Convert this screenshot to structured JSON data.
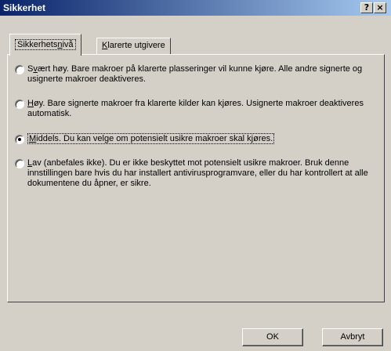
{
  "window": {
    "title": "Sikkerhet",
    "help_label": "?",
    "close_label": "×"
  },
  "tabs": [
    {
      "label_prefix": "Sikkerhets",
      "label_accel": "n",
      "label_suffix": "ivå",
      "active": true
    },
    {
      "label_prefix": "",
      "label_accel": "K",
      "label_suffix": "larerte utgivere",
      "active": false
    }
  ],
  "options": [
    {
      "label_prefix": "S",
      "label_accel": "v",
      "label_suffix": "ært høy. Bare makroer på klarerte plasseringer vil kunne kjøre. Alle andre signerte og usignerte makroer deaktiveres.",
      "selected": false
    },
    {
      "label_prefix": "",
      "label_accel": "H",
      "label_suffix": "øy. Bare signerte makroer fra klarerte kilder kan kjøres. Usignerte makroer deaktiveres automatisk.",
      "selected": false
    },
    {
      "label_prefix": "",
      "label_accel": "M",
      "label_suffix": "iddels. Du kan velge om potensielt usikre makroer skal kjøres.",
      "selected": true
    },
    {
      "label_prefix": "",
      "label_accel": "L",
      "label_suffix": "av (anbefales ikke). Du er ikke beskyttet mot potensielt usikre makroer. Bruk denne innstillingen bare hvis du har installert antivirusprogramvare, eller du har kontrollert at alle dokumentene du åpner, er sikre.",
      "selected": false
    }
  ],
  "buttons": {
    "ok": "OK",
    "cancel": "Avbryt"
  }
}
